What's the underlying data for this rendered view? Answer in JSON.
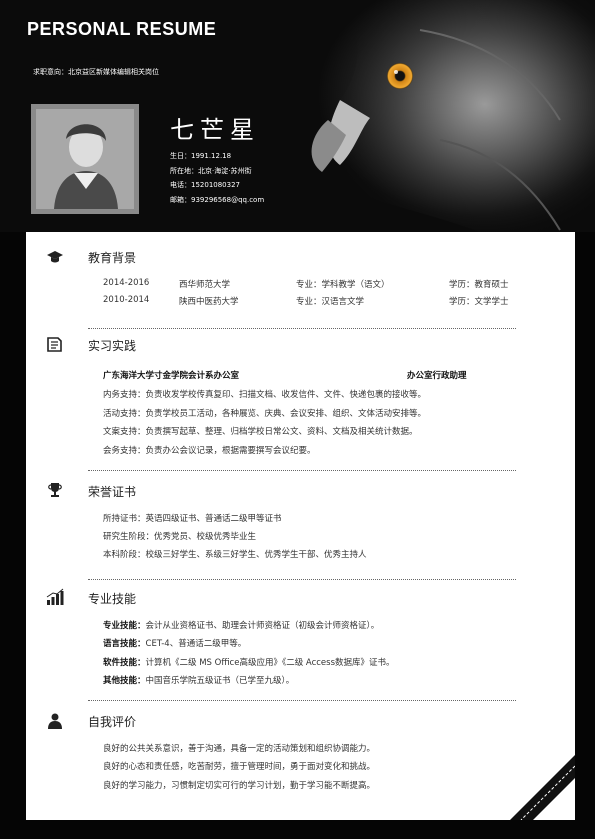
{
  "header": {
    "title": "PERSONAL RESUME",
    "objective": "求职意向：北京益区新媒体编辑相关岗位",
    "name": "七芒星",
    "info": [
      "生日：1991.12.18",
      "所在地：北京·海淀·苏州街",
      "电话：15201080327",
      "邮箱：939296568@qq.com"
    ]
  },
  "sections": {
    "education": {
      "title": "教育背景",
      "rows": [
        {
          "period": "2014-2016",
          "school": "西华师范大学",
          "major": "专业：学科教学（语文）",
          "degree": "学历：教育硕士"
        },
        {
          "period": "2010-2014",
          "school": "陕西中医药大学",
          "major": "专业：汉语言文学",
          "degree": "学历：文学学士"
        }
      ]
    },
    "practice": {
      "title": "实习实践",
      "org": "广东海洋大学寸金学院会计系办公室",
      "role": "办公室行政助理",
      "items": [
        "内务支持：负责收发学校传真复印、扫描文档、收发信件、文件、快递包裹的接收等。",
        "活动支持：负责学校员工活动，各种展览、庆典、会议安排、组织、文体活动安排等。",
        "文案支持：负责撰写起草、整理、归档学校日常公文、资料、文档及相关统计数据。",
        "会务支持：负责办公会议记录，根据需要撰写会议纪要。"
      ]
    },
    "honors": {
      "title": "荣誉证书",
      "items": [
        "所持证书：英语四级证书、普通话二级甲等证书",
        "研究生阶段：优秀党员、校级优秀毕业生",
        "本科阶段：校级三好学生、系级三好学生、优秀学生干部、优秀主持人"
      ]
    },
    "skills": {
      "title": "专业技能",
      "items": [
        {
          "label": "专业技能：",
          "text": "会计从业资格证书、助理会计师资格证（初级会计师资格证）。"
        },
        {
          "label": "语言技能：",
          "text": "CET-4、普通话二级甲等。"
        },
        {
          "label": "软件技能：",
          "text": "计算机《二级 MS Office高级应用》《二级 Access数据库》证书。"
        },
        {
          "label": "其他技能：",
          "text": "中国音乐学院五级证书（已学至九级）。"
        }
      ]
    },
    "evaluation": {
      "title": "自我评价",
      "items": [
        "良好的公共关系意识，善于沟通，具备一定的活动策划和组织协调能力。",
        "良好的心态和责任感，吃苦耐劳，擅于管理时间，勇于面对变化和挑战。",
        "良好的学习能力，习惯制定切实可行的学习计划，勤于学习能不断提高。"
      ]
    }
  },
  "icons": [
    "graduation-cap-icon",
    "book-icon",
    "trophy-icon",
    "bar-chart-icon",
    "person-icon"
  ]
}
